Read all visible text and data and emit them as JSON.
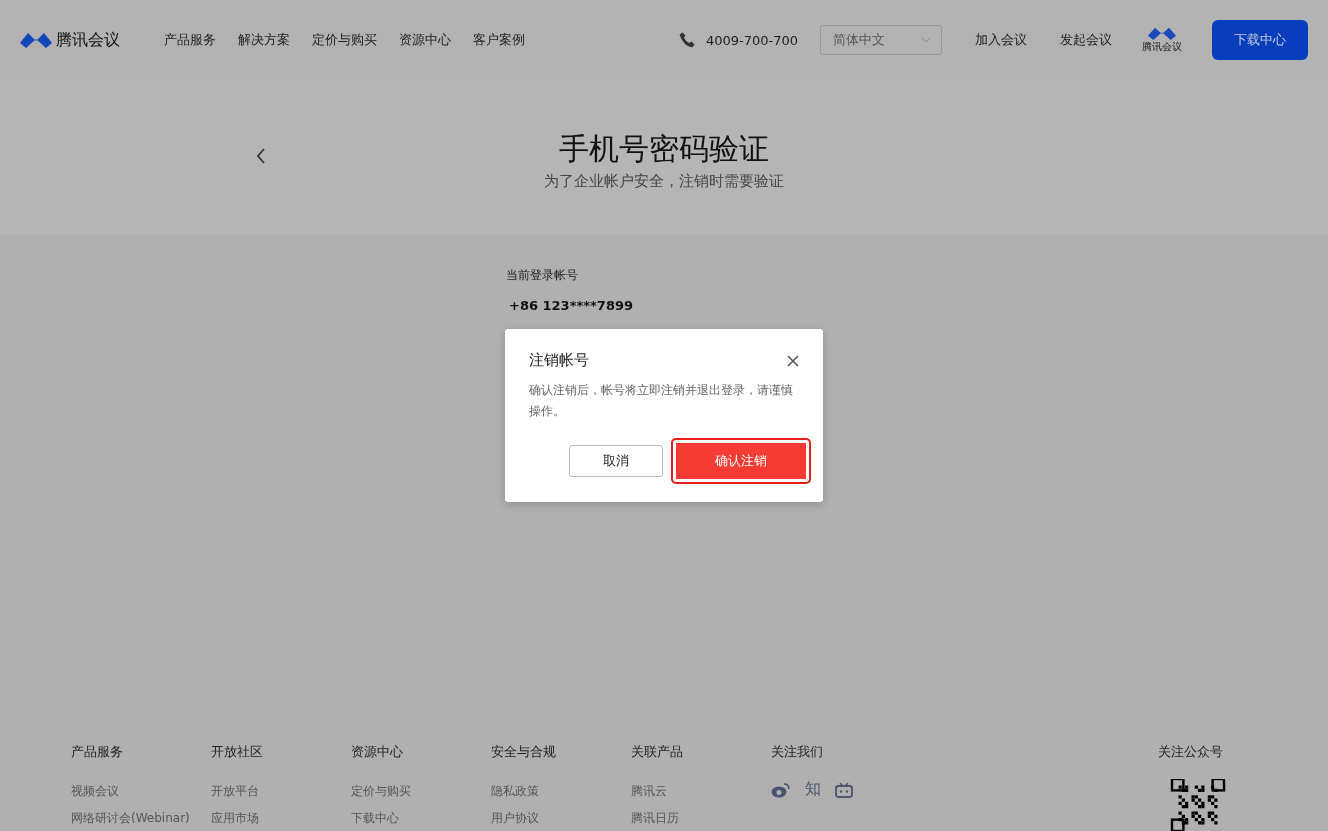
{
  "header": {
    "brand": "腾讯会议",
    "nav": [
      "产品服务",
      "解决方案",
      "定价与购买",
      "资源中心",
      "客户案例"
    ],
    "phone": "4009-700-700",
    "language": {
      "value": "简体中文"
    },
    "links": [
      "加入会议",
      "发起会议"
    ],
    "badge_label": "腾讯会议",
    "download": "下载中心"
  },
  "hero": {
    "title": "手机号密码验证",
    "subtitle": "为了企业帐户安全，注销时需要验证"
  },
  "account": {
    "label": "当前登录帐号",
    "value": "+86 123****7899"
  },
  "dialog": {
    "title": "注销帐号",
    "message": "确认注销后，帐号将立即注销并退出登录，请谨慎操作。",
    "cancel": "取消",
    "confirm": "确认注销",
    "confirm_highlighted": true
  },
  "footer": {
    "columns": [
      {
        "title": "产品服务",
        "links": [
          "视频会议",
          "网络研讨会(Webinar)"
        ]
      },
      {
        "title": "开放社区",
        "links": [
          "开放平台",
          "应用市场"
        ]
      },
      {
        "title": "资源中心",
        "links": [
          "定价与购买",
          "下载中心"
        ]
      },
      {
        "title": "安全与合规",
        "links": [
          "隐私政策",
          "用户协议"
        ]
      },
      {
        "title": "关联产品",
        "links": [
          "腾讯云",
          "腾讯日历"
        ]
      }
    ],
    "follow": {
      "title": "关注我们",
      "zhihu": "知"
    },
    "wechat": {
      "title": "关注公众号"
    }
  }
}
